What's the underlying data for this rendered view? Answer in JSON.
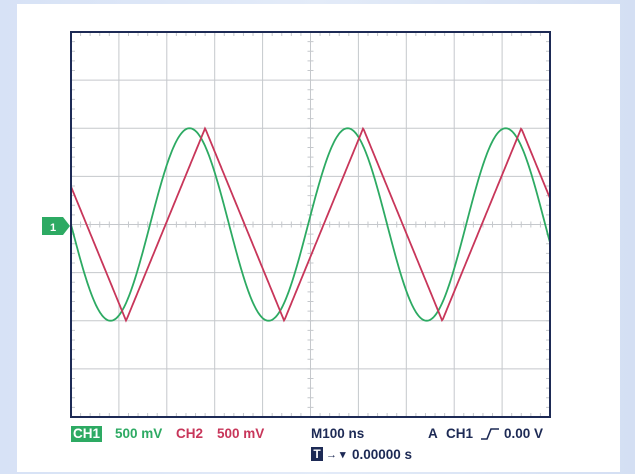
{
  "colors": {
    "frame": "#1d2a55",
    "grid": "#c5c8cc",
    "ch1": "#2daa63",
    "ch2": "#c8365a",
    "text": "#1d2a55"
  },
  "ch1_marker": "1",
  "status": {
    "ch1_label": "CH1",
    "ch1_scale": "500 mV",
    "ch2_label": "CH2",
    "ch2_scale": "500 mV",
    "timebase": "M100 ns",
    "trigger_mode": "A",
    "trigger_source": "CH1",
    "trigger_slope_icon": "rising-edge-icon",
    "trigger_level": "0.00 V",
    "trigger_position_icon": "trigger-t-icon",
    "trigger_arrow": "→ ▾",
    "trigger_time": "0.00000 s"
  },
  "screen": {
    "h_divisions": 10,
    "v_divisions": 8
  },
  "waveforms": {
    "ch1": {
      "shape": "sine",
      "amplitude_div": 2.0,
      "period_div": 3.3,
      "phase_crossing_div": 0.0
    },
    "ch2": {
      "shape": "triangle",
      "amplitude_div": 2.0,
      "period_div": 3.3,
      "peak_div": 2.8
    }
  }
}
